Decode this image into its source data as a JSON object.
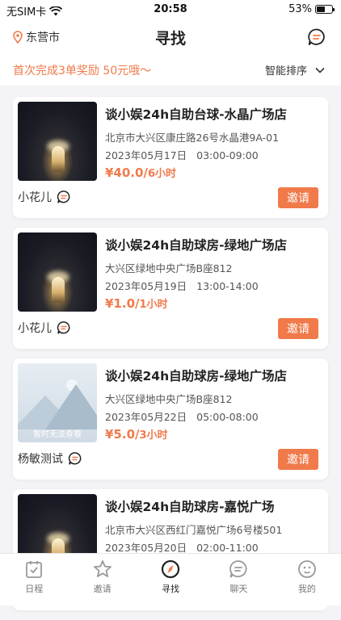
{
  "status": {
    "carrier": "无SIM卡",
    "time": "20:58",
    "battery": "53%",
    "battery_level": 0.53
  },
  "nav": {
    "location": "东营市",
    "title": "寻找"
  },
  "promo": {
    "text": "首次完成3单奖励 50元哦～",
    "sort_label": "智能排序"
  },
  "listings": [
    {
      "title": "谈小娱24h自助台球-水晶广场店",
      "address": "北京市大兴区康庄路26号水晶港9A-01",
      "date": "2023年05月17日",
      "time": "03:00-09:00",
      "price": "¥40.0/",
      "unit": "6小时",
      "host": "小花儿",
      "button": "邀请",
      "image": "photo"
    },
    {
      "title": "谈小娱24h自助球房-绿地广场店",
      "address": "大兴区绿地中央广场B座812",
      "date": "2023年05月19日",
      "time": "13:00-14:00",
      "price": "¥1.0/",
      "unit": "1小时",
      "host": "小花儿",
      "button": "邀请",
      "image": "photo"
    },
    {
      "title": "谈小娱24h自助球房-绿地广场店",
      "address": "大兴区绿地中央广场B座812",
      "date": "2023年05月22日",
      "time": "05:00-08:00",
      "price": "¥5.0/",
      "unit": "3小时",
      "host": "杨敏测试",
      "button": "邀请",
      "image": "placeholder",
      "image_text": "暂时无法查看"
    },
    {
      "title": "谈小娱24h自助球房-嘉悦广场",
      "address": "北京市大兴区西红门嘉悦广场6号楼501",
      "date": "2023年05月20日",
      "time": "02:00-11:00",
      "price": "",
      "unit": "",
      "host": "",
      "button": "",
      "image": "photo"
    }
  ],
  "tabs": [
    {
      "label": "日程",
      "icon": "calendar-icon"
    },
    {
      "label": "邀请",
      "icon": "star-icon"
    },
    {
      "label": "寻找",
      "icon": "compass-icon",
      "active": true
    },
    {
      "label": "聊天",
      "icon": "chat-icon"
    },
    {
      "label": "我的",
      "icon": "profile-icon"
    }
  ],
  "colors": {
    "accent": "#f07a4a",
    "background": "#f4f4f6"
  }
}
